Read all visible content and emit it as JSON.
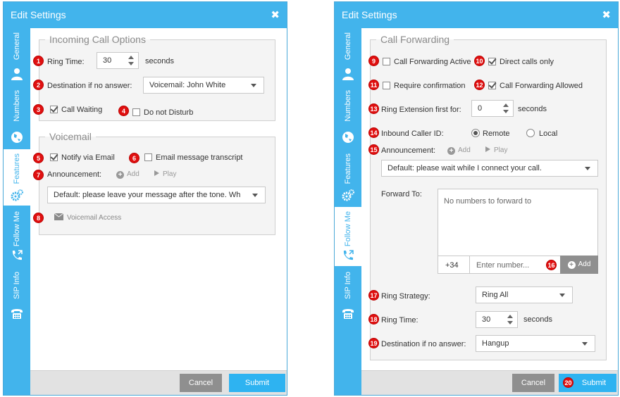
{
  "left_dialog": {
    "title": "Edit Settings",
    "close_label": "✖",
    "tabs": [
      {
        "label": "General",
        "icon": "user-icon"
      },
      {
        "label": "Numbers",
        "icon": "globe-icon"
      },
      {
        "label": "Features",
        "icon": "gears-icon",
        "active": true
      },
      {
        "label": "Follow Me",
        "icon": "phone-forward-icon"
      },
      {
        "label": "SIP Info",
        "icon": "phone-icon"
      }
    ],
    "incoming": {
      "legend": "Incoming Call Options",
      "ring_time_label": "Ring Time:",
      "ring_time_value": "30",
      "ring_time_unit": "seconds",
      "dest_label": "Destination if no answer:",
      "dest_value": "Voicemail: John White",
      "call_waiting_label": "Call Waiting",
      "dnd_label": "Do not Disturb"
    },
    "voicemail": {
      "legend": "Voicemail",
      "notify_label": "Notify via Email",
      "transcript_label": "Email message transcript",
      "announcement_label": "Announcement:",
      "add_label": "Add",
      "play_label": "Play",
      "announcement_value": "Default: please leave your message after the tone. Wh",
      "access_label": "Voicemail Access"
    },
    "cancel_label": "Cancel",
    "submit_label": "Submit",
    "badges": [
      "1",
      "2",
      "3",
      "4",
      "5",
      "6",
      "7",
      "8"
    ]
  },
  "right_dialog": {
    "title": "Edit Settings",
    "close_label": "✖",
    "tabs": [
      {
        "label": "General",
        "icon": "user-icon"
      },
      {
        "label": "Numbers",
        "icon": "globe-icon"
      },
      {
        "label": "Features",
        "icon": "gears-icon"
      },
      {
        "label": "Follow Me",
        "icon": "phone-forward-icon",
        "active": true
      },
      {
        "label": "SIP Info",
        "icon": "phone-icon"
      }
    ],
    "forwarding": {
      "legend": "Call Forwarding",
      "active_label": "Call Forwarding Active",
      "direct_label": "Direct calls only",
      "confirm_label": "Require confirmation",
      "allowed_label": "Call Forwarding Allowed",
      "ring_ext_label": "Ring Extension first for:",
      "ring_ext_value": "0",
      "ring_ext_unit": "seconds",
      "caller_id_label": "Inbound Caller ID:",
      "remote_label": "Remote",
      "local_label": "Local",
      "announcement_label": "Announcement:",
      "add_label": "Add",
      "play_label": "Play",
      "announcement_value": "Default: please wait while I connect your call.",
      "forward_to_label": "Forward To:",
      "forward_empty": "No numbers to forward to",
      "country_code": "+34",
      "number_placeholder": "Enter number...",
      "add_button": "Add",
      "strategy_label": "Ring Strategy:",
      "strategy_value": "Ring All",
      "ring_time_label": "Ring Time:",
      "ring_time_value": "30",
      "ring_time_unit": "seconds",
      "dest_label": "Destination if no answer:",
      "dest_value": "Hangup"
    },
    "cancel_label": "Cancel",
    "submit_label": "Submit",
    "badges": [
      "9",
      "10",
      "11",
      "12",
      "13",
      "14",
      "15",
      "16",
      "17",
      "18",
      "19",
      "20"
    ]
  },
  "colors": {
    "accent": "#42b4ec",
    "badge": "#e01010",
    "cancel": "#8f8f8f",
    "submit": "#2eb3f1"
  }
}
